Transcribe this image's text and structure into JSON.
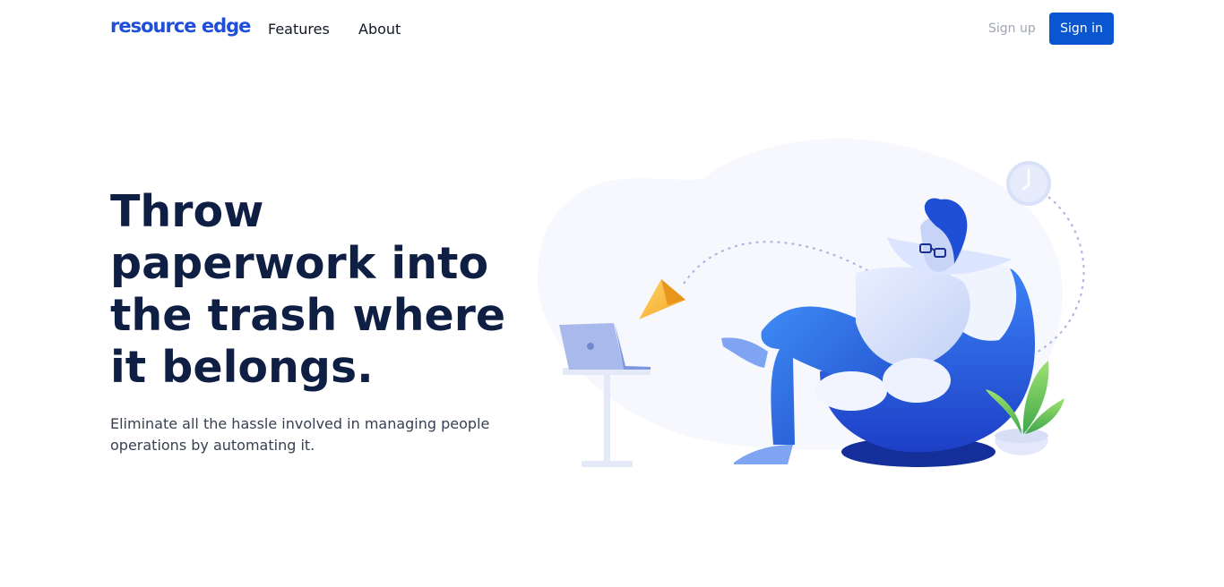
{
  "nav": {
    "logo": "resource edge",
    "links": [
      "Features",
      "About"
    ],
    "signup_label": "Sign up",
    "signin_label": "Sign in"
  },
  "hero": {
    "title": "Throw paperwork into the trash where it belongs.",
    "subtitle": "Eliminate all the hassle involved in managing people operations by automating it."
  },
  "colors": {
    "brand": "#1f4fd6",
    "button": "#0a56d0",
    "heading": "#0f1f44",
    "body_text": "#374151",
    "muted": "#a0a7b3"
  },
  "illustration": {
    "subject": "man-relaxing-in-bean-bag",
    "elements": [
      "laptop-on-stand",
      "paper-plane",
      "wall-clock",
      "potted-plant",
      "bean-bag-chair"
    ]
  }
}
